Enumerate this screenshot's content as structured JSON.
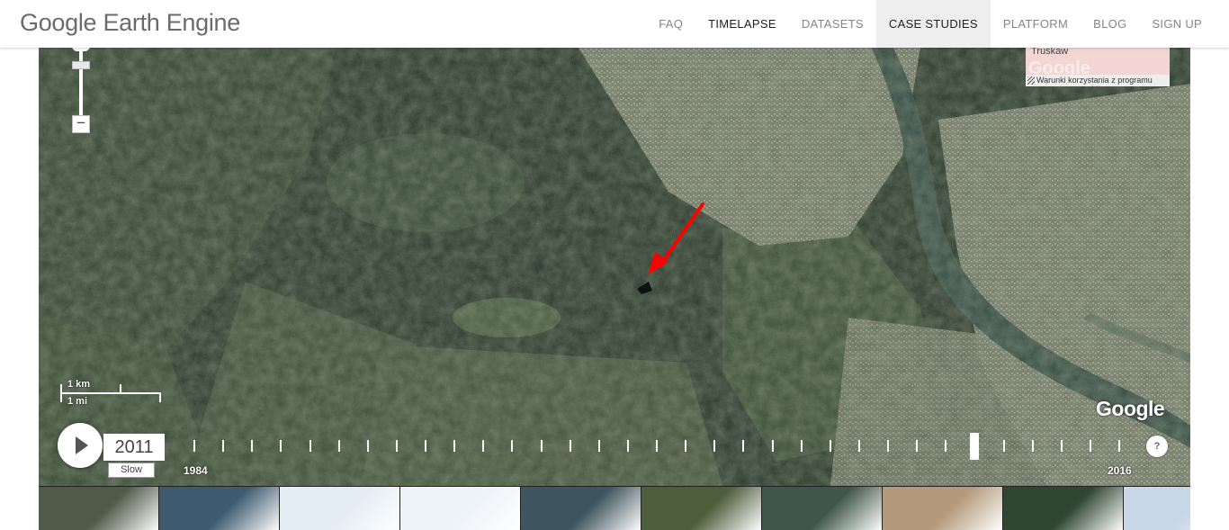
{
  "header": {
    "logo": "Google Earth Engine",
    "nav": [
      {
        "label": "FAQ",
        "tone": "light"
      },
      {
        "label": "TIMELAPSE",
        "tone": "dark"
      },
      {
        "label": "DATASETS",
        "tone": "light"
      },
      {
        "label": "CASE STUDIES",
        "tone": "active"
      },
      {
        "label": "PLATFORM",
        "tone": "light"
      },
      {
        "label": "BLOG",
        "tone": "light"
      },
      {
        "label": "SIGN UP",
        "tone": "light"
      }
    ]
  },
  "map": {
    "minimap_label": "Truskaw",
    "minimap_logo": "Google",
    "terms": "Warunki korzystania z programu",
    "scale_km": "1 km",
    "scale_mi": "1 mi",
    "watermark": "Google",
    "arrow_color": "#ff0000"
  },
  "timeline": {
    "current_year": "2011",
    "speed": "Slow",
    "start_year": "1984",
    "end_year": "2016",
    "years": [
      1984,
      1985,
      1986,
      1987,
      1988,
      1989,
      1990,
      1991,
      1992,
      1993,
      1994,
      1995,
      1996,
      1997,
      1998,
      1999,
      2000,
      2001,
      2002,
      2003,
      2004,
      2005,
      2006,
      2007,
      2008,
      2009,
      2010,
      2011,
      2012,
      2013,
      2014,
      2015,
      2016
    ],
    "current_index": 27,
    "help": "?"
  },
  "thumbnails": [
    {
      "name": "thumb-coastal-city",
      "color": "#4f5a48"
    },
    {
      "name": "thumb-lagoon",
      "color": "#3d5a6e"
    },
    {
      "name": "thumb-ice-1",
      "color": "#e4ecf5"
    },
    {
      "name": "thumb-ice-2",
      "color": "#eef3f8"
    },
    {
      "name": "thumb-delta",
      "color": "#3f5560"
    },
    {
      "name": "thumb-farmland",
      "color": "#4c5e3c"
    },
    {
      "name": "thumb-reservoir",
      "color": "#41564a"
    },
    {
      "name": "thumb-desert-city",
      "color": "#b49a7a"
    },
    {
      "name": "thumb-forest",
      "color": "#2f4630"
    },
    {
      "name": "thumb-glacier",
      "color": "#c9d6e6"
    }
  ]
}
